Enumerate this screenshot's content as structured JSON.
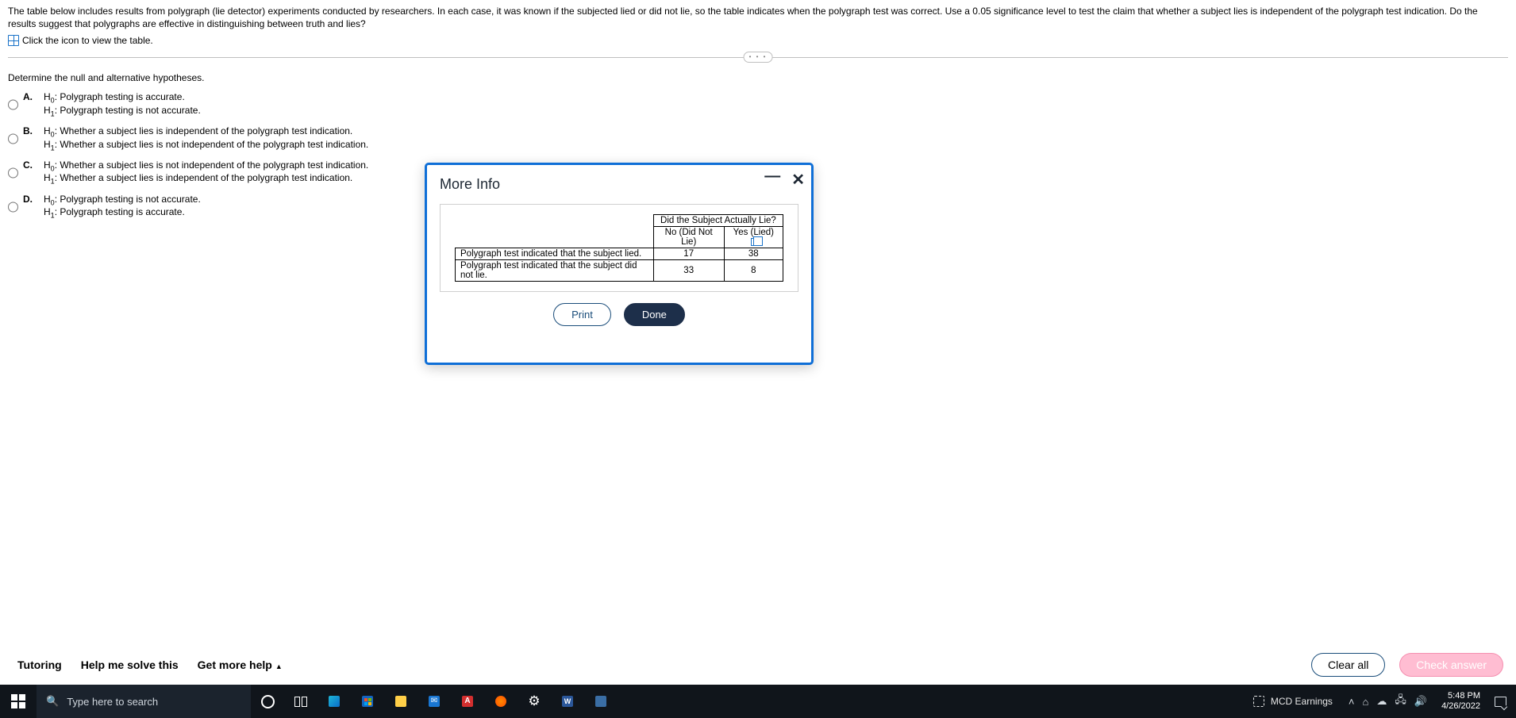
{
  "question": {
    "prompt": "The table below includes results from polygraph (lie detector) experiments conducted by researchers. In each case, it was known if the subjected lied or did not lie, so the table indicates when the polygraph test was correct. Use a 0.05 significance level to test the claim that whether a subject lies is independent of the polygraph test indication. Do the results suggest that polygraphs are effective in distinguishing between truth and lies?",
    "table_hint": "Click the icon to view the table.",
    "subquestion": "Determine the null and alternative hypotheses.",
    "options": {
      "A": {
        "h0": "Polygraph testing is accurate.",
        "h1": "Polygraph testing is not accurate."
      },
      "B": {
        "h0": "Whether a subject lies is independent of the polygraph test indication.",
        "h1": "Whether a subject lies is not independent of the polygraph test indication."
      },
      "C": {
        "h0": "Whether a subject lies is not independent of the polygraph test indication.",
        "h1": "Whether a subject lies is independent of the polygraph test indication."
      },
      "D": {
        "h0": "Polygraph testing is not accurate.",
        "h1": "Polygraph testing is accurate."
      }
    },
    "option_labels": {
      "A": "A.",
      "B": "B.",
      "C": "C.",
      "D": "D."
    }
  },
  "modal": {
    "title": "More Info",
    "table": {
      "header_span": "Did the Subject Actually Lie?",
      "col_no": "No (Did Not Lie)",
      "col_yes": "Yes (Lied)",
      "row1_label": "Polygraph test indicated that the subject lied.",
      "row1_no": "17",
      "row1_yes": "38",
      "row2_label": "Polygraph test indicated that the subject did not lie.",
      "row2_no": "33",
      "row2_yes": "8"
    },
    "buttons": {
      "print": "Print",
      "done": "Done"
    }
  },
  "chart_data": {
    "type": "table",
    "title": "Did the Subject Actually Lie?",
    "columns": [
      "No (Did Not Lie)",
      "Yes (Lied)"
    ],
    "rows": [
      {
        "label": "Polygraph test indicated that the subject lied.",
        "values": [
          17,
          38
        ]
      },
      {
        "label": "Polygraph test indicated that the subject did not lie.",
        "values": [
          33,
          8
        ]
      }
    ]
  },
  "footer": {
    "tutoring": "Tutoring",
    "help": "Help me solve this",
    "more": "Get more help",
    "clear": "Clear all",
    "check": "Check answer"
  },
  "taskbar": {
    "search_placeholder": "Type here to search",
    "ticker": "MCD Earnings",
    "time": "5:48 PM",
    "date": "4/26/2022"
  },
  "hypothesis_labels": {
    "h0_prefix": "H",
    "h0_sub": "0",
    "h1_prefix": "H",
    "h1_sub": "1",
    "colon": ": "
  }
}
